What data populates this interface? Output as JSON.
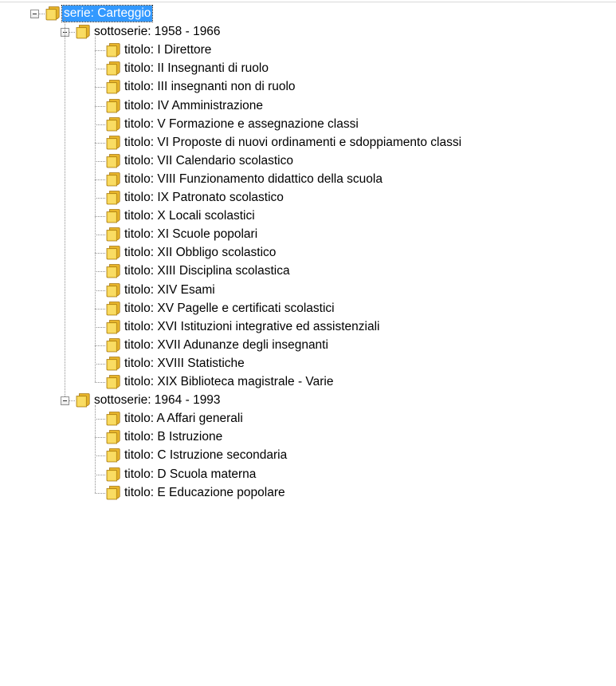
{
  "tree": {
    "root": {
      "label": "serie: Carteggio",
      "selected": true
    },
    "groups": [
      {
        "label": "sottoserie: 1958 - 1966",
        "items": [
          "titolo: I Direttore",
          "titolo: II Insegnanti di ruolo",
          "titolo: III insegnanti non di ruolo",
          "titolo: IV Amministrazione",
          "titolo: V Formazione e assegnazione classi",
          "titolo: VI Proposte di nuovi ordinamenti e sdoppiamento classi",
          "titolo: VII Calendario scolastico",
          "titolo: VIII Funzionamento didattico della scuola",
          "titolo: IX Patronato scolastico",
          "titolo: X Locali scolastici",
          "titolo: XI Scuole popolari",
          "titolo: XII Obbligo scolastico",
          "titolo: XIII Disciplina scolastica",
          "titolo: XIV Esami",
          "titolo: XV Pagelle e certificati scolastici",
          "titolo: XVI Istituzioni integrative ed assistenziali",
          "titolo: XVII Adunanze degli insegnanti",
          "titolo: XVIII Statistiche",
          "titolo: XIX Biblioteca magistrale - Varie"
        ]
      },
      {
        "label": "sottoserie: 1964 - 1993",
        "items": [
          "titolo: A Affari generali",
          "titolo: B Istruzione",
          "titolo: C Istruzione secondaria",
          "titolo: D Scuola materna",
          "titolo: E Educazione popolare"
        ]
      }
    ]
  },
  "icons": {
    "expander": "minus-box-icon",
    "node": "folder-icon"
  },
  "colors": {
    "selection_bg": "#3399ff",
    "selection_text": "#ffffff",
    "folder_fill": "#f5cf3d",
    "folder_edge": "#b8860b",
    "connector": "#8f8f8f"
  }
}
